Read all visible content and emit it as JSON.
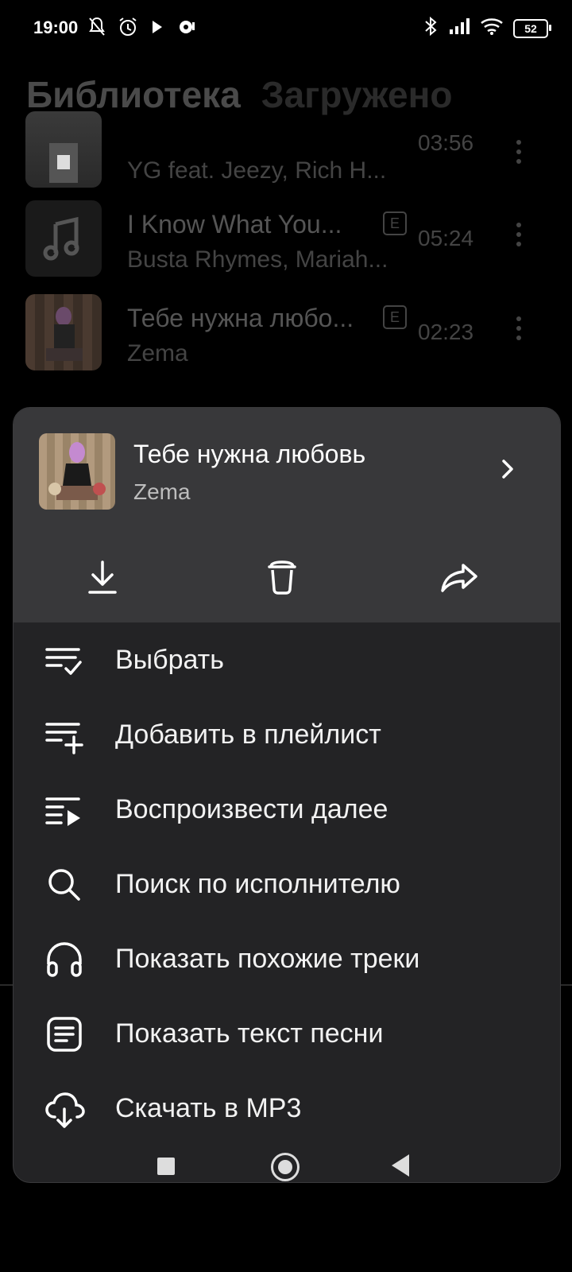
{
  "status_bar": {
    "time": "19:00",
    "battery": "52",
    "left_icons": [
      "bell-off-icon",
      "alarm-icon",
      "play-icon",
      "media-icon"
    ],
    "right_icons": [
      "bluetooth-icon",
      "signal-icon",
      "wifi-icon",
      "battery-icon"
    ]
  },
  "library": {
    "tabs": [
      {
        "label": "Библиотека",
        "active": true
      },
      {
        "label": "Загружено",
        "active": false
      }
    ],
    "tracks": [
      {
        "title": "",
        "artist": "YG feat. Jeezy, Rich H...",
        "duration": "03:56",
        "explicit": false
      },
      {
        "title": "I Know What You...",
        "artist": "Busta Rhymes, Mariah...",
        "duration": "05:24",
        "explicit": true
      },
      {
        "title": "Тебе нужна любо...",
        "artist": "Zema",
        "duration": "02:23",
        "explicit": true
      }
    ],
    "explicit_badge": "E"
  },
  "sheet": {
    "track": {
      "title": "Тебе нужна любовь",
      "artist": "Zema"
    },
    "actions": [
      "download-icon",
      "delete-icon",
      "share-icon"
    ],
    "menu": [
      {
        "label": "Выбрать",
        "icon": "list-check-icon"
      },
      {
        "label": "Добавить в плейлист",
        "icon": "playlist-add-icon"
      },
      {
        "label": "Воспроизвести далее",
        "icon": "play-next-icon"
      },
      {
        "label": "Поиск по исполнителю",
        "icon": "search-icon"
      },
      {
        "label": "Показать похожие треки",
        "icon": "headphones-icon"
      },
      {
        "label": "Показать текст песни",
        "icon": "lyrics-icon"
      },
      {
        "label": "Скачать в MP3",
        "icon": "cloud-download-icon"
      }
    ]
  },
  "colors": {
    "sheet_bg": "#232325",
    "sheet_header_bg": "#38383a",
    "text_primary": "#f2f2f2",
    "text_secondary": "#bdbdbd"
  }
}
